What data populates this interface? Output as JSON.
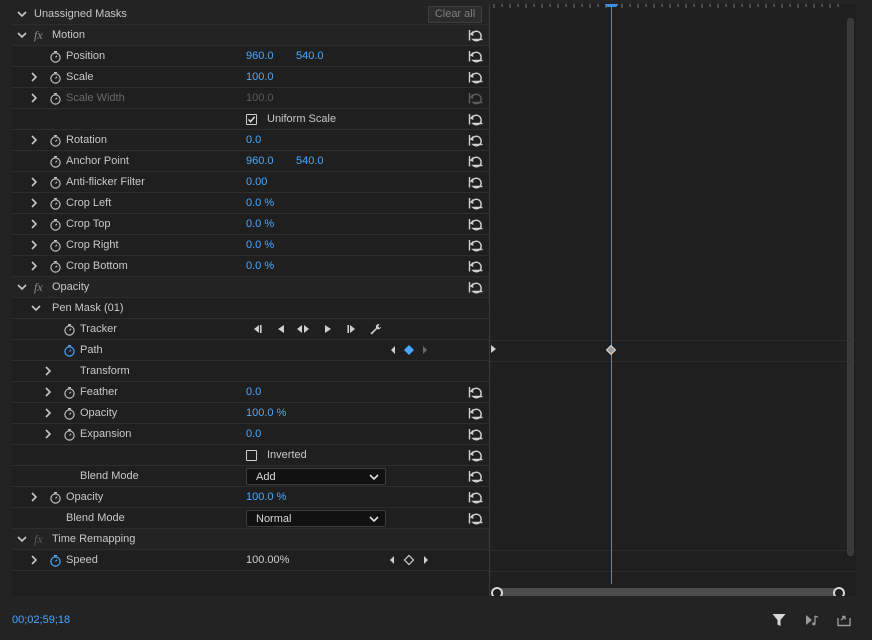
{
  "header": {
    "title": "Unassigned Masks",
    "clear_all": "Clear all"
  },
  "rows": {
    "motion": {
      "fx": "fx",
      "label": "Motion"
    },
    "position": {
      "label": "Position",
      "value_x": "960.0",
      "value_y": "540.0"
    },
    "scale": {
      "label": "Scale",
      "value": "100.0"
    },
    "scale_width": {
      "label": "Scale Width",
      "value": "100.0"
    },
    "uniform_scale": {
      "label": "Uniform Scale",
      "checked": true
    },
    "rotation": {
      "label": "Rotation",
      "value": "0.0"
    },
    "anchor_point": {
      "label": "Anchor Point",
      "value_x": "960.0",
      "value_y": "540.0"
    },
    "anti_flicker": {
      "label": "Anti-flicker Filter",
      "value": "0.00"
    },
    "crop_left": {
      "label": "Crop Left",
      "value": "0.0 %"
    },
    "crop_top": {
      "label": "Crop Top",
      "value": "0.0 %"
    },
    "crop_right": {
      "label": "Crop Right",
      "value": "0.0 %"
    },
    "crop_bottom": {
      "label": "Crop Bottom",
      "value": "0.0 %"
    },
    "opacity_group": {
      "fx": "fx",
      "label": "Opacity"
    },
    "pen_mask": {
      "label": "Pen Mask (01)"
    },
    "tracker": {
      "label": "Tracker"
    },
    "path": {
      "label": "Path"
    },
    "transform": {
      "label": "Transform"
    },
    "feather": {
      "label": "Feather",
      "value": "0.0"
    },
    "mask_opacity": {
      "label": "Opacity",
      "value": "100.0 %"
    },
    "expansion": {
      "label": "Expansion",
      "value": "0.0"
    },
    "inverted": {
      "label": "Inverted",
      "checked": false
    },
    "mask_blend_mode": {
      "label": "Blend Mode",
      "selected": "Add"
    },
    "opacity": {
      "label": "Opacity",
      "value": "100.0 %"
    },
    "blend_mode": {
      "label": "Blend Mode",
      "selected": "Normal"
    },
    "time_remapping": {
      "fx": "fx",
      "label": "Time Remapping"
    },
    "speed": {
      "label": "Speed",
      "value": "100.00%"
    }
  },
  "footer": {
    "timecode": "00;02;59;18"
  },
  "icons": {
    "stopwatch": "stopwatch-icon",
    "reset": "reset-parameter-icon",
    "filter": "filter-icon",
    "play_audio": "play-audio-icon",
    "export": "export-icon",
    "wrench": "wrench-icon"
  },
  "colors": {
    "accent": "#4aa8ff",
    "playhead": "#3f8fe0",
    "panel_bg": "#1f1f1f"
  }
}
